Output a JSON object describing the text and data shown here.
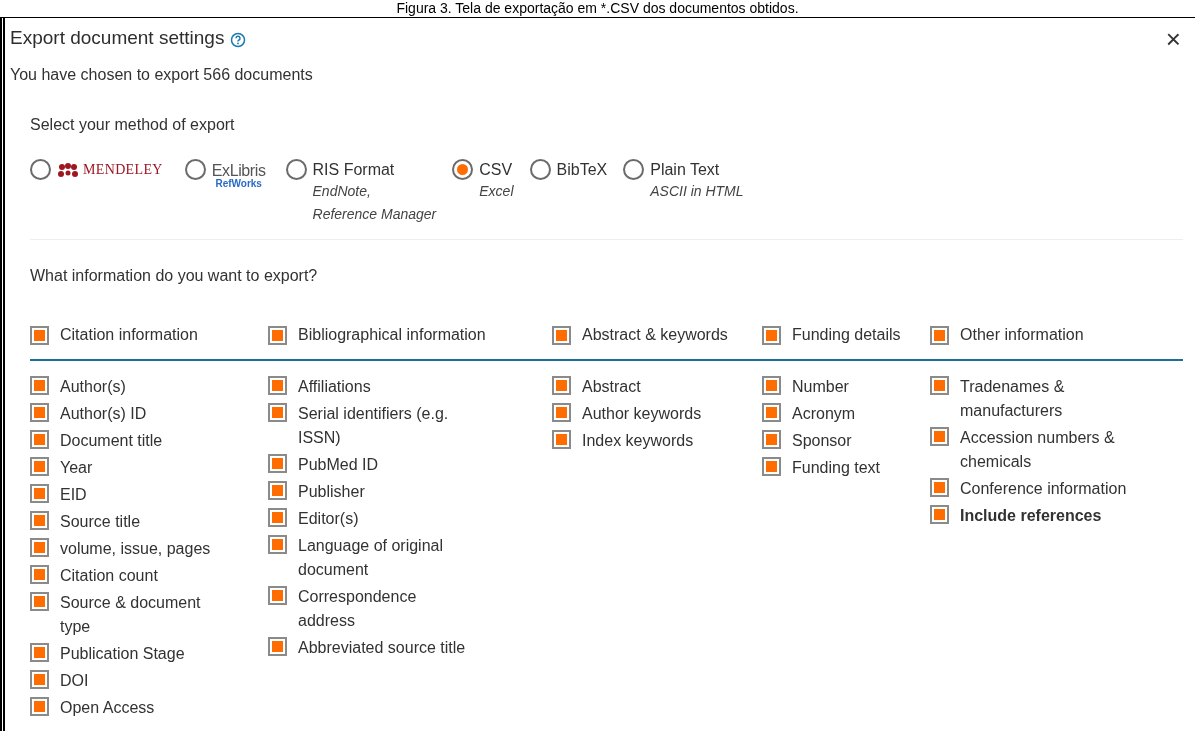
{
  "caption": "Figura 3. Tela de exportação em *.CSV dos documentos obtidos.",
  "dialog": {
    "title": "Export document settings",
    "close": "×",
    "summary": "You have chosen to export 566 documents",
    "method_heading": "Select your method of export",
    "methods": [
      {
        "kind": "mendeley",
        "label": "MENDELEY",
        "selected": false
      },
      {
        "kind": "refworks",
        "label": "ExLibris",
        "sublabel": "RefWorks",
        "selected": false
      },
      {
        "kind": "text",
        "label": "RIS Format",
        "notes": [
          "EndNote,",
          "Reference Manager"
        ],
        "selected": false
      },
      {
        "kind": "text",
        "label": "CSV",
        "notes": [
          "Excel"
        ],
        "selected": true
      },
      {
        "kind": "text",
        "label": "BibTeX",
        "selected": false
      },
      {
        "kind": "text",
        "label": "Plain Text",
        "notes": [
          "ASCII in HTML"
        ],
        "selected": false
      }
    ],
    "info_heading": "What information do you want to export?",
    "groups": [
      {
        "label": "Citation information",
        "checked": true,
        "items": [
          {
            "label": "Author(s)",
            "checked": true
          },
          {
            "label": "Author(s) ID",
            "checked": true
          },
          {
            "label": "Document title",
            "checked": true
          },
          {
            "label": "Year",
            "checked": true
          },
          {
            "label": "EID",
            "checked": true
          },
          {
            "label": "Source title",
            "checked": true
          },
          {
            "label": "volume, issue, pages",
            "checked": true
          },
          {
            "label": "Citation count",
            "checked": true
          },
          {
            "label": "Source & document type",
            "checked": true
          },
          {
            "label": "Publication Stage",
            "checked": true
          },
          {
            "label": "DOI",
            "checked": true
          },
          {
            "label": "Open Access",
            "checked": true
          }
        ]
      },
      {
        "label": "Bibliographical information",
        "checked": true,
        "items": [
          {
            "label": "Affiliations",
            "checked": true
          },
          {
            "label": "Serial identifiers (e.g. ISSN)",
            "checked": true
          },
          {
            "label": "PubMed ID",
            "checked": true
          },
          {
            "label": "Publisher",
            "checked": true
          },
          {
            "label": "Editor(s)",
            "checked": true
          },
          {
            "label": "Language of original document",
            "checked": true
          },
          {
            "label": "Correspondence address",
            "checked": true
          },
          {
            "label": "Abbreviated source title",
            "checked": true
          }
        ]
      },
      {
        "label": "Abstract & keywords",
        "checked": true,
        "items": [
          {
            "label": "Abstract",
            "checked": true
          },
          {
            "label": "Author keywords",
            "checked": true
          },
          {
            "label": "Index keywords",
            "checked": true
          }
        ]
      },
      {
        "label": "Funding details",
        "checked": true,
        "items": [
          {
            "label": "Number",
            "checked": true
          },
          {
            "label": "Acronym",
            "checked": true
          },
          {
            "label": "Sponsor",
            "checked": true
          },
          {
            "label": "Funding text",
            "checked": true
          }
        ]
      },
      {
        "label": "Other information",
        "checked": true,
        "items": [
          {
            "label": "Tradenames & manufacturers",
            "checked": true
          },
          {
            "label": "Accession numbers & chemicals",
            "checked": true
          },
          {
            "label": "Conference information",
            "checked": true
          },
          {
            "label": "Include references",
            "checked": true,
            "bold": true
          }
        ]
      }
    ]
  }
}
